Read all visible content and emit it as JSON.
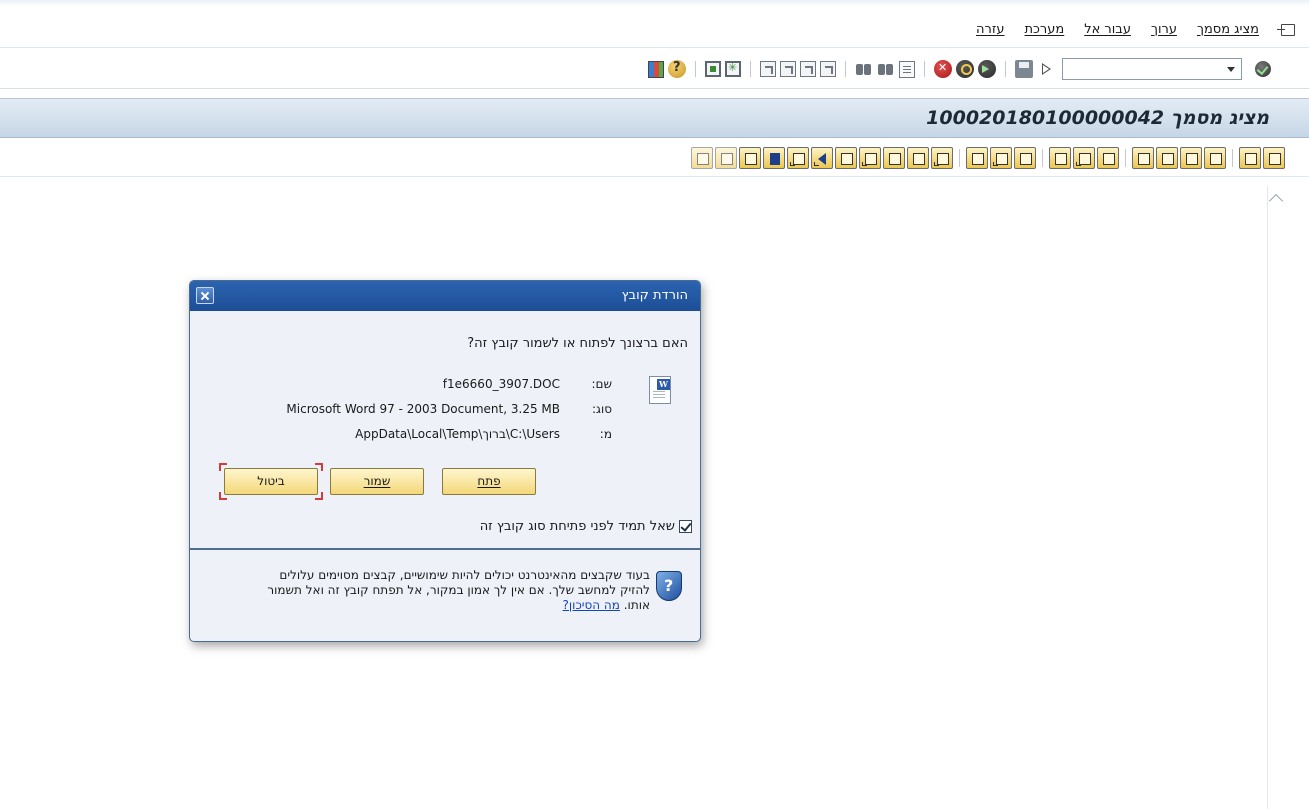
{
  "menu": {
    "items": [
      "מציג מסמך",
      "ערוך",
      "עבור אל",
      "מערכת",
      "עזרה"
    ]
  },
  "toolbar": {
    "command_field_value": ""
  },
  "title": {
    "text": "מציג מסמך  100020180100000042"
  },
  "dialog": {
    "title": "הורדת קובץ",
    "question": "האם ברצונך לפתוח או לשמור קובץ זה?",
    "name_label": "שם:",
    "name_value": "f1e6660_3907.DOC",
    "type_label": "סוג:",
    "type_value": "Microsoft Word 97 - 2003 Document, 3.25 MB",
    "from_label": "מ:",
    "from_value": "C:\\Users\\ברוך\\AppData\\Local\\Temp",
    "buttons": {
      "open": "פתח",
      "save": "שמור",
      "cancel": "ביטול"
    },
    "checkbox_label": "שאל תמיד לפני פתיחת סוג קובץ זה",
    "checkbox_checked": true,
    "warning_text": "בעוד שקבצים מהאינטרנט יכולים להיות שימושיים, קבצים מסוימים עלולים להזיק למחשב שלך. אם אין לך אמון במקור, אל תפתח קובץ זה ואל תשמור אותו.",
    "warning_link": "מה הסיכון?"
  }
}
